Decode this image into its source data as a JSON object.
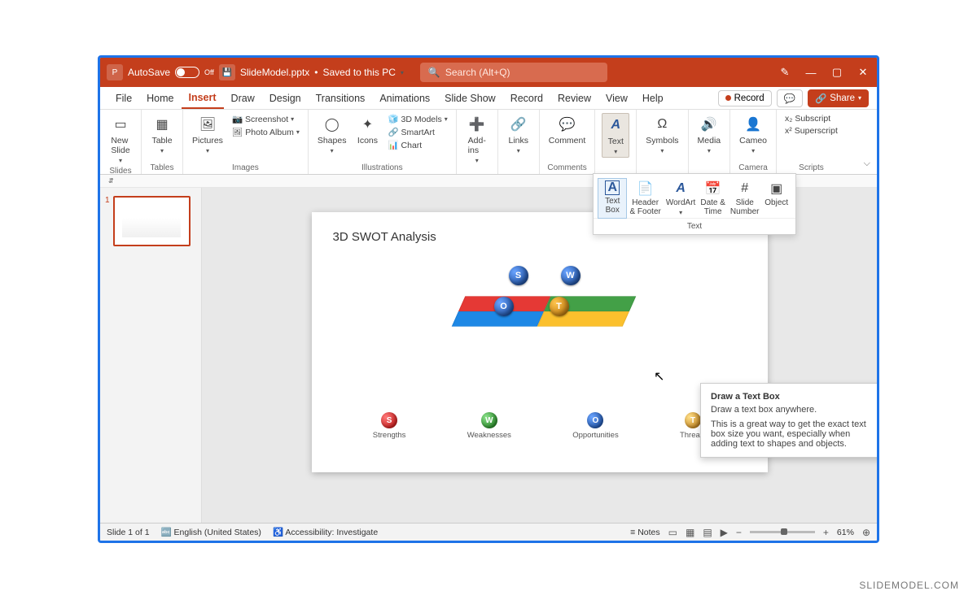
{
  "titlebar": {
    "autosave_label": "AutoSave",
    "autosave_state": "Off",
    "filename": "SlideModel.pptx",
    "saved_state": "Saved to this PC",
    "search_placeholder": "Search (Alt+Q)"
  },
  "menubar": {
    "items": [
      "File",
      "Home",
      "Insert",
      "Draw",
      "Design",
      "Transitions",
      "Animations",
      "Slide Show",
      "Record",
      "Review",
      "View",
      "Help"
    ],
    "active": "Insert",
    "record_btn": "Record",
    "share_btn": "Share"
  },
  "ribbon": {
    "groups": {
      "slides": {
        "label": "Slides",
        "new_slide": "New\nSlide"
      },
      "tables": {
        "label": "Tables",
        "table": "Table"
      },
      "images": {
        "label": "Images",
        "pictures": "Pictures",
        "screenshot": "Screenshot",
        "photo_album": "Photo Album"
      },
      "illustrations": {
        "label": "Illustrations",
        "shapes": "Shapes",
        "icons": "Icons",
        "models": "3D Models",
        "smartart": "SmartArt",
        "chart": "Chart"
      },
      "addins": {
        "label": "",
        "btn": "Add-\nins"
      },
      "links": {
        "label": "",
        "btn": "Links"
      },
      "comments": {
        "label": "Comments",
        "btn": "Comment"
      },
      "text": {
        "label": "",
        "btn": "Text"
      },
      "symbols": {
        "label": "",
        "btn": "Symbols"
      },
      "media": {
        "label": "",
        "btn": "Media"
      },
      "camera": {
        "label": "Camera",
        "btn": "Cameo"
      },
      "scripts": {
        "label": "Scripts",
        "sub": "Subscript",
        "sup": "Superscript"
      }
    }
  },
  "flyout": {
    "group_label": "Text",
    "items": [
      {
        "label": "Text\nBox"
      },
      {
        "label": "Header\n& Footer"
      },
      {
        "label": "WordArt"
      },
      {
        "label": "Date &\nTime"
      },
      {
        "label": "Slide\nNumber"
      },
      {
        "label": "Object"
      }
    ]
  },
  "tooltip": {
    "title": "Draw a Text Box",
    "line1": "Draw a text box anywhere.",
    "line2": "This is a great way to get the exact text box size you want, especially when adding text to shapes and objects."
  },
  "slide": {
    "title": "3D SWOT Analysis",
    "balls": {
      "s": "S",
      "w": "W",
      "o": "O",
      "t": "T"
    },
    "legend": [
      {
        "letter": "S",
        "label": "Strengths",
        "cls": "red"
      },
      {
        "letter": "W",
        "label": "Weaknesses",
        "cls": "grn"
      },
      {
        "letter": "O",
        "label": "Opportunities",
        "cls": "blu"
      },
      {
        "letter": "T",
        "label": "Threats",
        "cls": "yel"
      }
    ]
  },
  "thumbs": {
    "n1": "1"
  },
  "status": {
    "slide": "Slide 1 of 1",
    "lang": "English (United States)",
    "access": "Accessibility: Investigate",
    "notes": "Notes",
    "zoom": "61%"
  },
  "watermark": "SLIDEMODEL.COM"
}
